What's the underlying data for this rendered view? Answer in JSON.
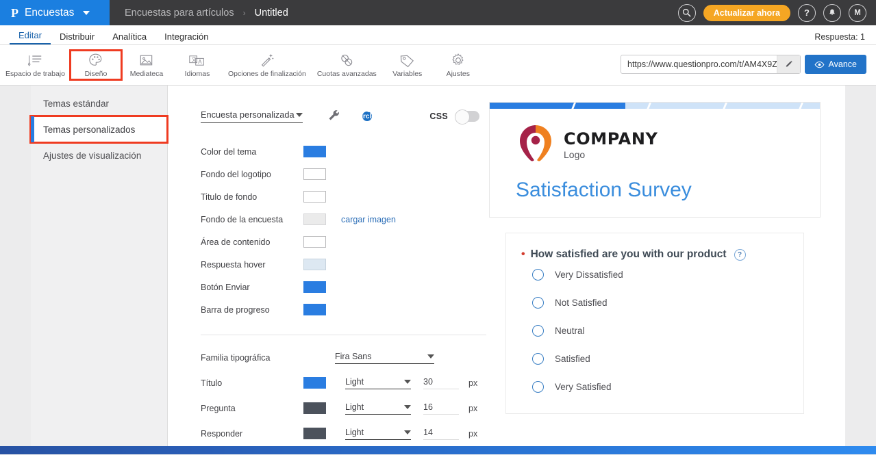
{
  "topbar": {
    "brand_logo": "P",
    "brand_name": "Encuestas",
    "breadcrumb_parent": "Encuestas para artículos",
    "breadcrumb_sep": "›",
    "breadcrumb_current": "Untitled",
    "search_icon": "search-icon",
    "upgrade_label": "Actualizar ahora",
    "help_icon": "?",
    "bell_icon": "●",
    "avatar_initial": "M"
  },
  "nav": {
    "tabs": [
      {
        "label": "Editar",
        "active": true
      },
      {
        "label": "Distribuir",
        "active": false
      },
      {
        "label": "Analítica",
        "active": false
      },
      {
        "label": "Integración",
        "active": false
      }
    ],
    "response_count": "Respuesta: 1"
  },
  "toolbar": {
    "items": [
      {
        "label": "Espacio de trabajo",
        "icon": "workspace-icon",
        "selected": false
      },
      {
        "label": "Diseño",
        "icon": "palette-icon",
        "selected": true
      },
      {
        "label": "Mediateca",
        "icon": "media-library-icon",
        "selected": false
      },
      {
        "label": "Idiomas",
        "icon": "languages-icon",
        "selected": false
      },
      {
        "label": "Opciones de finalización",
        "icon": "magic-wand-icon",
        "selected": false
      },
      {
        "label": "Cuotas avanzadas",
        "icon": "quota-link-icon",
        "selected": false
      },
      {
        "label": "Variables",
        "icon": "tag-icon",
        "selected": false
      },
      {
        "label": "Ajustes",
        "icon": "gear-icon",
        "selected": false
      }
    ],
    "url_value": "https://www.questionpro.com/t/AM4X9Z",
    "url_edit_icon": "pencil-icon",
    "preview_label": "Avance",
    "preview_icon": "eye-icon"
  },
  "sidebar": {
    "items": [
      {
        "label": "Temas estándar",
        "active": false,
        "highlighted": false
      },
      {
        "label": "Temas personalizados",
        "active": true,
        "highlighted": true
      },
      {
        "label": "Ajustes de visualización",
        "active": false,
        "highlighted": false
      }
    ]
  },
  "settings": {
    "theme_select_value": "Encuesta personalizada",
    "wrench_icon": "wrench-icon",
    "help_icon": "help-circle-icon",
    "css_label": "CSS",
    "css_toggle_state": "off",
    "color_rows": [
      {
        "label": "Color del tema",
        "color": "#2a7de1",
        "border": "#2a7de1",
        "link": ""
      },
      {
        "label": "Fondo del logotipo",
        "color": "#ffffff",
        "border": "#b9b9bb",
        "link": ""
      },
      {
        "label": "Titulo de fondo",
        "color": "#ffffff",
        "border": "#b9b9bb",
        "link": ""
      },
      {
        "label": "Fondo de la encuesta",
        "color": "#ebebeb",
        "border": "#d6d6d8",
        "link": "cargar imagen"
      },
      {
        "label": "Área de contenido",
        "color": "#ffffff",
        "border": "#b9b9bb",
        "link": ""
      },
      {
        "label": "Respuesta hover",
        "color": "#dde8f2",
        "border": "#c6d3de",
        "link": ""
      },
      {
        "label": "Botón Enviar",
        "color": "#2a7de1",
        "border": "#2a7de1",
        "link": ""
      },
      {
        "label": "Barra de progreso",
        "color": "#2a7de1",
        "border": "#2a7de1",
        "link": ""
      }
    ],
    "font_family_label": "Familia tipográfica",
    "font_family_value": "Fira Sans",
    "font_rows": [
      {
        "label": "Título",
        "color": "#2a7de1",
        "weight": "Light",
        "size": "30",
        "unit": "px"
      },
      {
        "label": "Pregunta",
        "color": "#4c525c",
        "weight": "Light",
        "size": "16",
        "unit": "px"
      },
      {
        "label": "Responder",
        "color": "#4c525c",
        "weight": "Light",
        "size": "14",
        "unit": "px"
      }
    ]
  },
  "preview": {
    "progress_percent": 41,
    "logo_company": "COMPANY",
    "logo_sub": "Logo",
    "survey_title": "Satisfaction Survey",
    "question": "How satisfied are you with our product",
    "question_required": true,
    "question_help_icon": "?",
    "options": [
      "Very Dissatisfied",
      "Not Satisfied",
      "Neutral",
      "Satisfied",
      "Very Satisfied"
    ]
  },
  "colors": {
    "accent": "#2a7de1",
    "brand_blue": "#1b7fe0",
    "orange": "#f5a623",
    "highlight_red": "#ef3b21",
    "topbar_dark": "#3b3b3d"
  }
}
